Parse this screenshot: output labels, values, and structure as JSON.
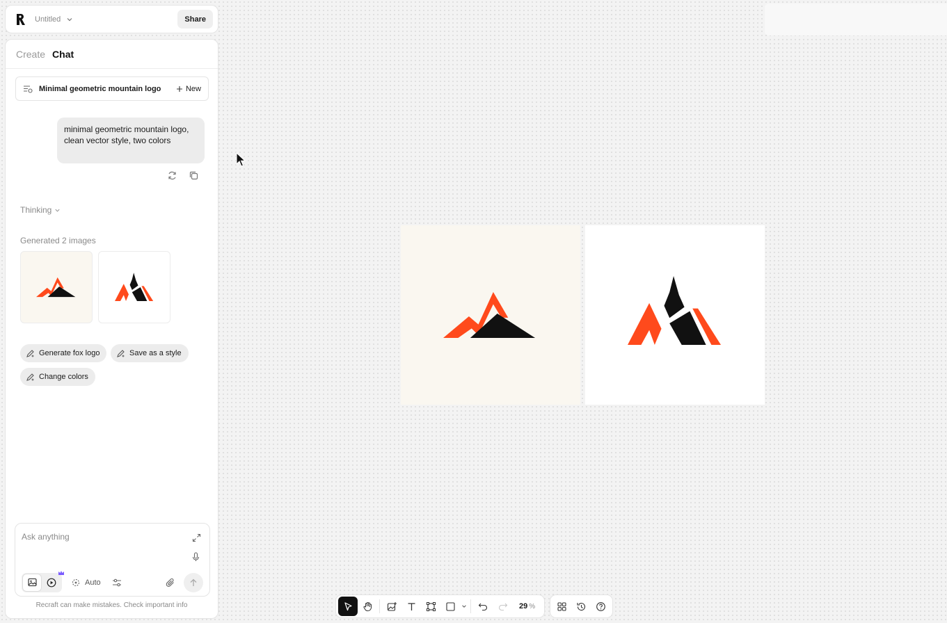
{
  "header": {
    "doc_title": "Untitled",
    "share_label": "Share",
    "logo_icon": "recraft-logo-icon"
  },
  "panel": {
    "tabs": [
      {
        "label": "Create",
        "active": false
      },
      {
        "label": "Chat",
        "active": true
      }
    ],
    "chat_title": "Minimal geometric mountain logo",
    "new_label": "New",
    "user_message": "minimal geometric mountain logo, clean vector style, two colors",
    "thinking_label": "Thinking",
    "generated_label": "Generated 2 images",
    "suggestions": [
      {
        "label": "Generate fox logo"
      },
      {
        "label": "Save as a style"
      },
      {
        "label": "Change colors"
      }
    ],
    "composer": {
      "placeholder": "Ask anything",
      "auto_label": "Auto"
    },
    "disclaimer": "Recraft can make mistakes. Check important info"
  },
  "toolbar": {
    "zoom_value": "29",
    "zoom_unit": "%"
  },
  "colors": {
    "accent_orange": "#ff4a1c",
    "ink": "#111111",
    "cream": "#faf7f0",
    "crown_purple": "#7b5cff"
  }
}
